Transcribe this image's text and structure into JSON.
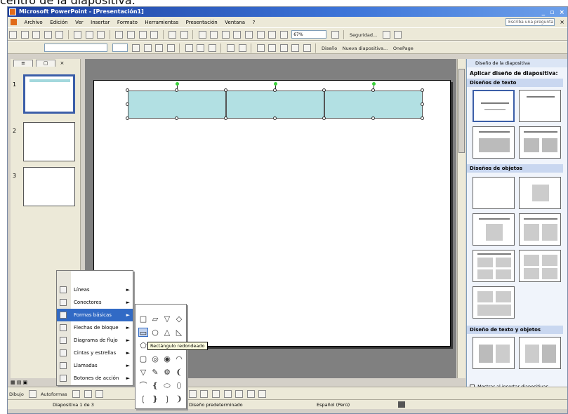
{
  "caption": "centro de la diapositiva.",
  "titlebar": {
    "title": "Microsoft PowerPoint - [Presentación1]",
    "controls": "_ ▫ ×"
  },
  "menubar": {
    "items": [
      "Archivo",
      "Edición",
      "Ver",
      "Insertar",
      "Formato",
      "Herramientas",
      "Presentación",
      "Ventana",
      "?"
    ],
    "help_placeholder": "Escriba una pregunta",
    "close": "×"
  },
  "toolbar1": {
    "zoom": "67%",
    "security": "Seguridad...",
    "icons": [
      "new-icon",
      "open-icon",
      "save-icon"
    ]
  },
  "toolbar2": {
    "new_slide": "Nueva diapositiva...",
    "design": "Diseño",
    "onepage": "OnePage"
  },
  "left_pane": {
    "tab_close": "×",
    "slide_numbers": [
      "1",
      "2",
      "3"
    ]
  },
  "task_pane": {
    "header": "Diseño de la diapositiva",
    "title": "Aplicar diseño de diapositiva:",
    "sections": [
      "Diseños de texto",
      "Diseños de objetos",
      "Diseño de texto y objetos"
    ],
    "checkbox_label": "Mostrar al insertar diapositivas"
  },
  "drawbar": {
    "draw": "Dibujo",
    "autoshapes": "Autoformas"
  },
  "statusbar": {
    "slide": "Diapositiva 1 de 3",
    "design": "Diseño predeterminado",
    "language": "Español (Perú)"
  },
  "autoshapes_menu": {
    "items": [
      "Líneas",
      "Conectores",
      "Formas básicas",
      "Flechas de bloque",
      "Diagrama de flujo",
      "Cintas y estrellas",
      "Llamadas",
      "Botones de acción"
    ],
    "highlighted_index": 2,
    "tooltip": "Rectángulo redondeado"
  },
  "basic_shapes": [
    "□",
    "▱",
    "▽",
    "◇",
    "▭",
    "○",
    "△",
    "◺",
    "⬠",
    "⬡",
    "⬢",
    "⬣",
    "▢",
    "◎",
    "◉",
    "◠",
    "▽",
    "✎",
    "⚙",
    "❨",
    "⌒",
    "❴",
    "⬭",
    "⬯",
    "❲",
    "❵",
    "❳",
    "❩"
  ],
  "colors": {
    "accent": "#316ac5",
    "shape_fill": "#b2e0e3",
    "title_bar": "#1d3f9e"
  }
}
